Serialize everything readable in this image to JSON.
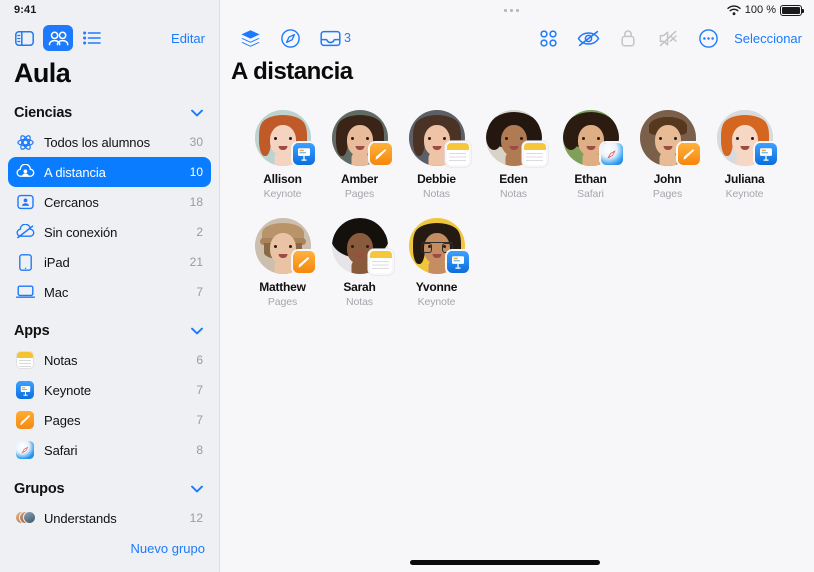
{
  "status_bar": {
    "time": "9:41",
    "battery_percent": "100 %",
    "wifi_icon": "wifi-icon",
    "battery_icon": "battery-icon",
    "drag_handle_icon": "drag-handle-dots-icon"
  },
  "sidebar": {
    "toolbar": {
      "sidebar_toggle_icon": "sidebar-toggle-icon",
      "people_view_icon": "people-grid-view-icon",
      "list_view_icon": "list-view-icon",
      "edit_label": "Editar"
    },
    "title": "Aula",
    "sections": [
      {
        "key": "ciencias",
        "label": "Ciencias",
        "items": [
          {
            "label": "Todos los alumnos",
            "count": "30",
            "icon": "all-students-icon",
            "selected": false
          },
          {
            "label": "A distancia",
            "count": "10",
            "icon": "remote-cloud-person-icon",
            "selected": true
          },
          {
            "label": "Cercanos",
            "count": "18",
            "icon": "nearby-person-icon",
            "selected": false
          },
          {
            "label": "Sin conexión",
            "count": "2",
            "icon": "cloud-slash-icon",
            "selected": false
          },
          {
            "label": "iPad",
            "count": "21",
            "icon": "ipad-icon",
            "selected": false
          },
          {
            "label": "Mac",
            "count": "7",
            "icon": "mac-laptop-icon",
            "selected": false
          }
        ]
      },
      {
        "key": "apps",
        "label": "Apps",
        "items": [
          {
            "label": "Notas",
            "count": "6",
            "icon": "notes-app-icon",
            "selected": false
          },
          {
            "label": "Keynote",
            "count": "7",
            "icon": "keynote-app-icon",
            "selected": false
          },
          {
            "label": "Pages",
            "count": "7",
            "icon": "pages-app-icon",
            "selected": false
          },
          {
            "label": "Safari",
            "count": "8",
            "icon": "safari-app-icon",
            "selected": false
          }
        ]
      },
      {
        "key": "grupos",
        "label": "Grupos",
        "items": [
          {
            "label": "Understands",
            "count": "12",
            "icon": "group-avatars-icon",
            "selected": false
          }
        ]
      }
    ],
    "new_group_label": "Nuevo grupo"
  },
  "main": {
    "toolbar_left": [
      {
        "name": "layers-icon",
        "badge": ""
      },
      {
        "name": "compass-icon",
        "badge": ""
      },
      {
        "name": "inbox-tray-icon",
        "badge": "3"
      }
    ],
    "toolbar_right": [
      {
        "name": "grid-four-dots-icon",
        "enabled": true
      },
      {
        "name": "eye-slash-icon",
        "enabled": true
      },
      {
        "name": "lock-icon",
        "enabled": false
      },
      {
        "name": "speaker-slash-icon",
        "enabled": false
      },
      {
        "name": "more-circle-icon",
        "enabled": true
      }
    ],
    "select_label": "Seleccionar",
    "title": "A distancia",
    "students": [
      {
        "name": "Allison",
        "app": "Keynote",
        "badge": "keynote",
        "skin": "#f4d3c0",
        "hair": "#c05a28",
        "hairstyle": "long",
        "bg": "#bcd3cf",
        "glasses": false
      },
      {
        "name": "Amber",
        "app": "Pages",
        "badge": "pages",
        "skin": "#e8bb9a",
        "hair": "#3a2418",
        "hairstyle": "long",
        "bg": "#5f6b63",
        "glasses": false
      },
      {
        "name": "Debbie",
        "app": "Notas",
        "badge": "notas",
        "skin": "#eec3a6",
        "hair": "#4a3224",
        "hairstyle": "long",
        "bg": "#5c6066",
        "glasses": false
      },
      {
        "name": "Eden",
        "app": "Notas",
        "badge": "notas",
        "skin": "#b07a52",
        "hair": "#231710",
        "hairstyle": "curly",
        "bg": "#d9d2c8",
        "glasses": false
      },
      {
        "name": "Ethan",
        "app": "Safari",
        "badge": "safari",
        "skin": "#e0ae84",
        "hair": "#2b1b11",
        "hairstyle": "curly",
        "bg": "#7fa05a",
        "glasses": false
      },
      {
        "name": "John",
        "app": "Pages",
        "badge": "pages",
        "skin": "#e6bb96",
        "hair": "#56381f",
        "hairstyle": "short",
        "bg": "#7a5f4a",
        "glasses": false
      },
      {
        "name": "Juliana",
        "app": "Keynote",
        "badge": "keynote",
        "skin": "#f6d7c4",
        "hair": "#d4661f",
        "hairstyle": "long",
        "bg": "#d8dade",
        "glasses": false
      },
      {
        "name": "Matthew",
        "app": "Pages",
        "badge": "pages",
        "skin": "#e9c3a3",
        "hair": "#8a6a45",
        "hairstyle": "hat",
        "bg": "#cdbfae",
        "glasses": false
      },
      {
        "name": "Sarah",
        "app": "Notas",
        "badge": "notas",
        "skin": "#8a5a3c",
        "hair": "#14100c",
        "hairstyle": "afro",
        "bg": "#e6e4e6",
        "glasses": false
      },
      {
        "name": "Yvonne",
        "app": "Keynote",
        "badge": "keynote",
        "skin": "#c48d62",
        "hair": "#241a12",
        "hairstyle": "long",
        "bg": "#f0c63d",
        "glasses": true
      }
    ]
  },
  "colors": {
    "accent": "#1d7afc",
    "selected_row": "#0a7cff",
    "sidebar_bg": "#eef0f3",
    "main_bg": "#f7f7f9",
    "muted_text": "#a6a6ad",
    "disabled_icon": "#c3c3c8"
  },
  "home_indicator": "home-indicator-bar"
}
